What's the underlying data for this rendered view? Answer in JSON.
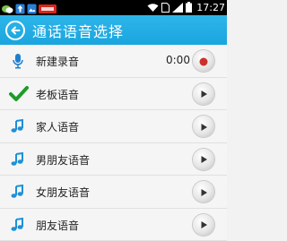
{
  "status_bar": {
    "time": "17:27",
    "icons": [
      "wechat-icon",
      "upload-icon",
      "image-icon",
      "app-badge-icon",
      "wifi-icon",
      "sim-icon",
      "signal-icon",
      "battery-icon"
    ]
  },
  "header": {
    "title": "通话语音选择",
    "back_icon": "back-arrow-icon",
    "color": "#1ea8e0"
  },
  "list": {
    "items": [
      {
        "label": "新建录音",
        "icon": "microphone-icon",
        "time": "0:00",
        "action": "record-icon"
      },
      {
        "label": "老板语音",
        "icon": "checkmark-icon",
        "action": "play-icon"
      },
      {
        "label": "家人语音",
        "icon": "music-note-icon",
        "action": "play-icon"
      },
      {
        "label": "男朋友语音",
        "icon": "music-note-icon",
        "action": "play-icon"
      },
      {
        "label": "女朋友语音",
        "icon": "music-note-icon",
        "action": "play-icon"
      },
      {
        "label": "朋友语音",
        "icon": "music-note-icon",
        "action": "play-icon"
      }
    ]
  },
  "colors": {
    "accent_blue": "#1ea8e0",
    "check_green": "#1e9c2a",
    "record_red": "#c8322a"
  }
}
